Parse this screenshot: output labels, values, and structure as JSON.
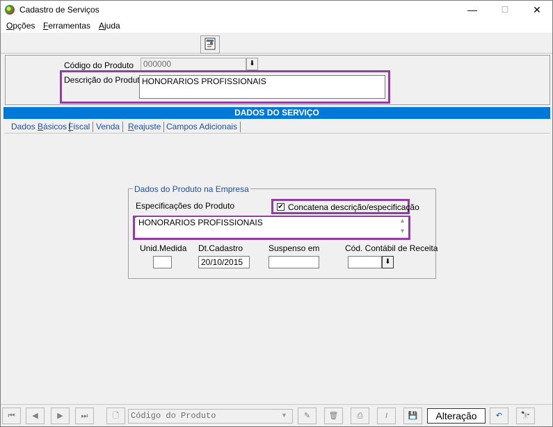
{
  "window": {
    "title": "Cadastro de Serviços",
    "minimize": "—",
    "maximize": "☐",
    "close": "✕"
  },
  "menu": {
    "opcoes_first": "O",
    "opcoes_rest": "pções",
    "ferramentas_first": "F",
    "ferramentas_rest": "erramentas",
    "ajuda_first": "A",
    "ajuda_rest": "juda"
  },
  "header": {
    "codigo_label": "Código do Produto",
    "codigo_value": "000000",
    "descricao_label": "Descrição do Produto",
    "descricao_value": "HONORARIOS PROFISSIONAIS"
  },
  "section_title": "DADOS DO SERVIÇO",
  "tabs": [
    {
      "first": "Dados ",
      "rest": "Básicos",
      "under": "B"
    },
    {
      "label": "Fiscal"
    },
    {
      "label": "Venda"
    },
    {
      "label": "Reajuste"
    },
    {
      "label": "Campos Adicionais"
    }
  ],
  "tab_labels": {
    "t0a": "Dados ",
    "t0u": "B",
    "t0b": "ásicos",
    "t1u": "F",
    "t1b": "iscal",
    "t2": "Venda",
    "t3u": "R",
    "t3b": "eajuste",
    "t4": "Campos Adicionais"
  },
  "group": {
    "title": "Dados do Produto na Empresa",
    "espec_label": "Especificações do Produto",
    "concat_label": "Concatena descrição/especificação",
    "concat_checked": true,
    "espec_value": "HONORARIOS PROFISSIONAIS",
    "unid_label": "Unid.Medida",
    "unid_value": "",
    "dtcad_label": "Dt.Cadastro",
    "dtcad_value": "20/10/2015",
    "susp_label": "Suspenso em",
    "susp_value": "",
    "cod_contabil_label": "Cód. Contábil de Receita",
    "cod_contabil_value": ""
  },
  "navbar": {
    "combo_value": "Código do Produto",
    "status": "Alteração"
  },
  "colors": {
    "accent": "#0078d7",
    "highlight": "#8e3f9f",
    "tab_text": "#1e4fa0"
  }
}
